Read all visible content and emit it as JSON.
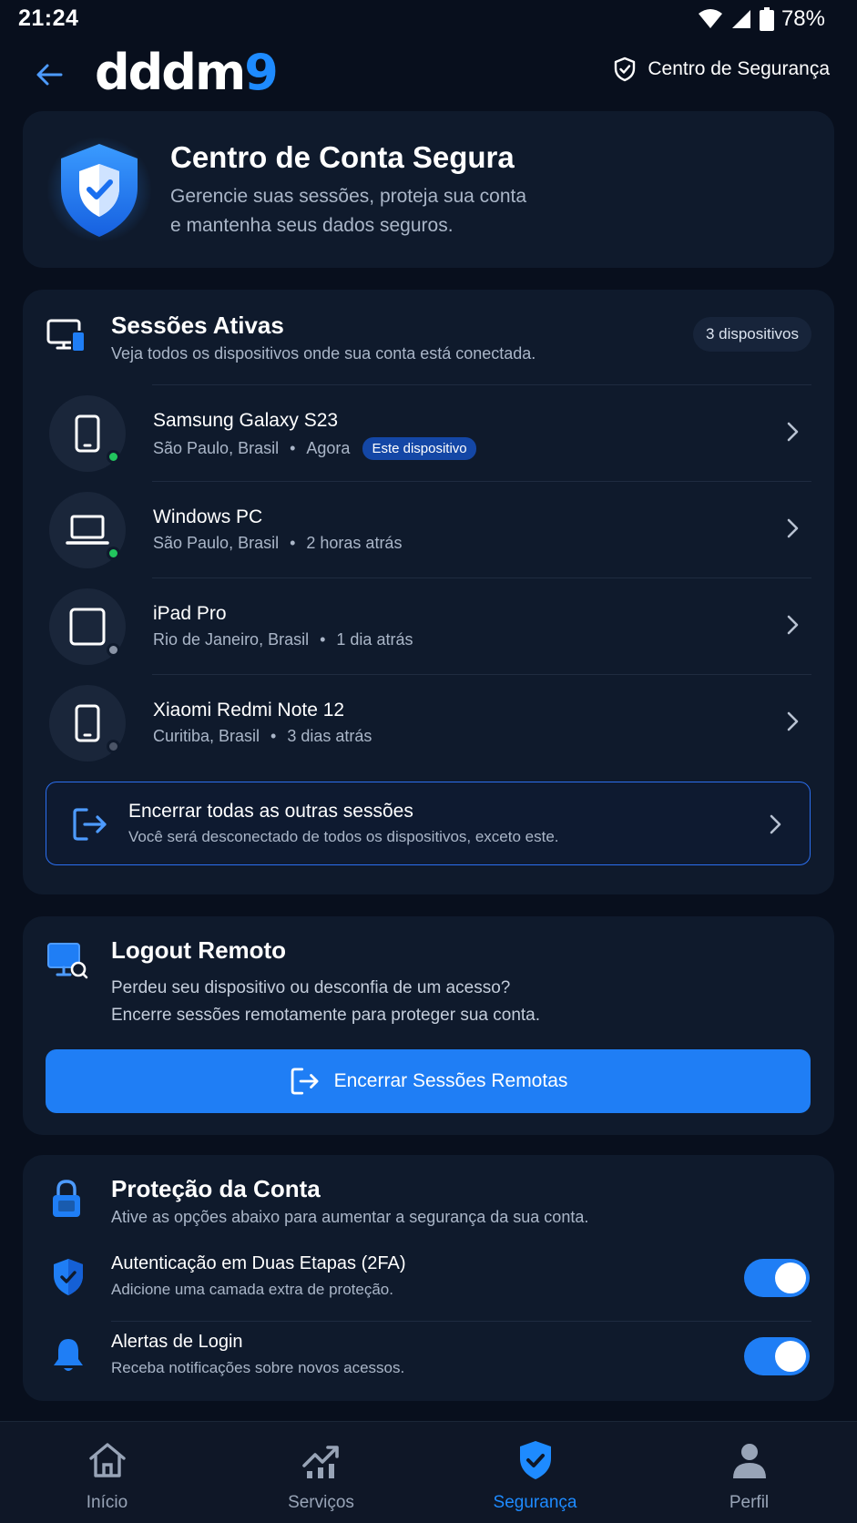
{
  "status_bar": {
    "time": "21:24",
    "battery": "78%"
  },
  "header": {
    "logo_part1": "dddm",
    "logo_part2": "9",
    "security_center_link": "Centro de Segurança"
  },
  "hero": {
    "title": "Centro de Conta Segura",
    "description_line1": "Gerencie suas sessões, proteja sua conta",
    "description_line2": "e mantenha seus dados seguros."
  },
  "sessions": {
    "title": "Sessões Ativas",
    "subtitle": "Veja todos os dispositivos onde sua conta está conectada.",
    "device_count": "3 dispositivos",
    "devices": [
      {
        "name": "Samsung Galaxy S23",
        "location": "São Paulo, Brasil",
        "time": "Agora",
        "badge": "Este dispositivo",
        "status": "online",
        "icon": "smartphone-icon"
      },
      {
        "name": "Windows PC",
        "location": "São Paulo, Brasil",
        "time": "2 horas atrás",
        "status": "online",
        "icon": "laptop-icon"
      },
      {
        "name": "iPad Pro",
        "location": "Rio de Janeiro, Brasil",
        "time": "1 dia atrás",
        "status": "offline",
        "icon": "tablet-icon"
      },
      {
        "name": "Xiaomi Redmi Note 12",
        "location": "Curitiba, Brasil",
        "time": "3 dias atrás",
        "status": "offline",
        "icon": "smartphone-icon"
      }
    ],
    "end_others": {
      "title": "Encerrar todas as outras sessões",
      "subtitle": "Você será desconectado de todos os dispositivos, exceto este."
    }
  },
  "remote_logout": {
    "title": "Logout Remoto",
    "description_line1": "Perdeu seu dispositivo ou desconfia de um acesso?",
    "description_line2": "Encerre sessões remotamente para proteger sua conta.",
    "button_label": "Encerrar Sessões Remotas"
  },
  "protection": {
    "title": "Proteção da Conta",
    "subtitle": "Ative as opções abaixo para aumentar a segurança da sua conta.",
    "options": [
      {
        "title": "Autenticação em Duas Etapas (2FA)",
        "subtitle": "Adicione uma camada extra de proteção.",
        "enabled": true
      },
      {
        "title": "Alertas de Login",
        "subtitle": "Receba notificações sobre novos acessos.",
        "enabled": true
      }
    ]
  },
  "bottom_nav": [
    {
      "label": "Início",
      "icon": "home-icon",
      "active": false
    },
    {
      "label": "Serviços",
      "icon": "chart-icon",
      "active": false
    },
    {
      "label": "Segurança",
      "icon": "shield-icon",
      "active": true
    },
    {
      "label": "Perfil",
      "icon": "person-icon",
      "active": false
    }
  ],
  "colors": {
    "background": "#080f1d",
    "card": "#0f1a2c",
    "accent": "#1f7ef5",
    "online": "#22c55e",
    "offline": "#8a94a6"
  }
}
